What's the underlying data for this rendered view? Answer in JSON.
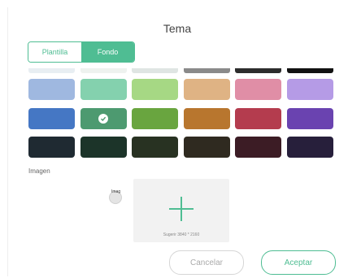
{
  "dialog": {
    "title": "Tema",
    "tabs": [
      {
        "label": "Plantilla",
        "active": false
      },
      {
        "label": "Fondo",
        "active": true
      }
    ],
    "section_label": "Imagen",
    "radio_tag": "Imag",
    "upload_hint": "Sugerir 3840 * 2160",
    "cancel_label": "Cancelar",
    "accept_label": "Aceptar"
  },
  "colors": {
    "accent": "#4fbd93",
    "top_row": [
      "#e8eef2",
      "#eef2ef",
      "#dfe5e3",
      "#8a8a8a",
      "#2d2d2d",
      "#121212"
    ],
    "rows": [
      [
        "#9fb8e0",
        "#84d1ae",
        "#a6d884",
        "#dfb384",
        "#e08ea6",
        "#b59be6"
      ],
      [
        "#4577c4",
        "#4d9a70",
        "#69a53f",
        "#b8762e",
        "#b43c4e",
        "#6a43b0"
      ],
      [
        "#1f2a32",
        "#1c3429",
        "#283222",
        "#2f2a20",
        "#3c1c25",
        "#271f3b"
      ]
    ],
    "selected": [
      1,
      1
    ]
  }
}
